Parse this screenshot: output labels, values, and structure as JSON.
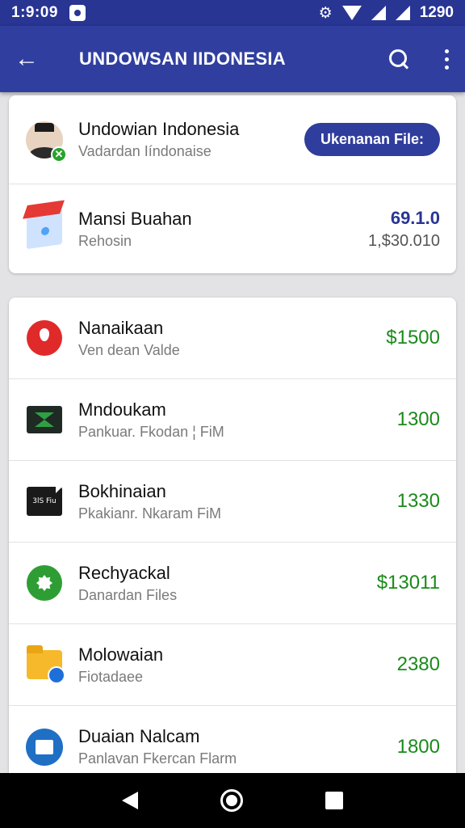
{
  "status_bar": {
    "time": "1:9:09",
    "battery_text": "1290",
    "icons": [
      "notification-icon",
      "alarm-icon",
      "wifi-icon",
      "signal-icon",
      "signal-full-icon"
    ]
  },
  "app_bar": {
    "title": "UNDOWSAN IIDONESIA",
    "back_icon": "back-arrow-icon",
    "search_icon": "search-icon",
    "more_icon": "more-vert-icon"
  },
  "top_card": {
    "profile": {
      "name": "Undowian Indonesia",
      "subtitle": "Vadardan Iíndonaise",
      "button_label": "Ukenanan File:"
    },
    "summary": {
      "title": "Mansi Buahan",
      "subtitle": "Rehosin",
      "amount_primary": "69.1.0",
      "amount_secondary": "1,$30.010"
    }
  },
  "list": {
    "items": [
      {
        "icon": "pin-icon",
        "title": "Nanaikaan",
        "subtitle": "Ven dean Valde",
        "amount": "$1500"
      },
      {
        "icon": "screen-icon",
        "title": "Mndoukam",
        "subtitle": "Pankuar. Fkodan ¦ FiM",
        "amount": "1300"
      },
      {
        "icon": "film-icon",
        "icon_text": "3lS Fiu",
        "title": "Bokhinaian",
        "subtitle": "Pkakianr. Nkaram FiM",
        "amount": "1330"
      },
      {
        "icon": "gear-icon",
        "title": "Rechyackal",
        "subtitle": "Danardan Files",
        "amount": "$13011"
      },
      {
        "icon": "folder-icon",
        "title": "Molowaian",
        "subtitle": "Fiotadaee",
        "amount": "2380"
      },
      {
        "icon": "folder-blue-icon",
        "title": "Duaian Nalcam",
        "subtitle": "Panlavan Fkercan Flarm",
        "amount": "1800"
      }
    ]
  },
  "colors": {
    "app_bar": "#303f9f",
    "status_bar": "#283593",
    "amount_green": "#1b8a1b",
    "amount_blue": "#283593"
  }
}
